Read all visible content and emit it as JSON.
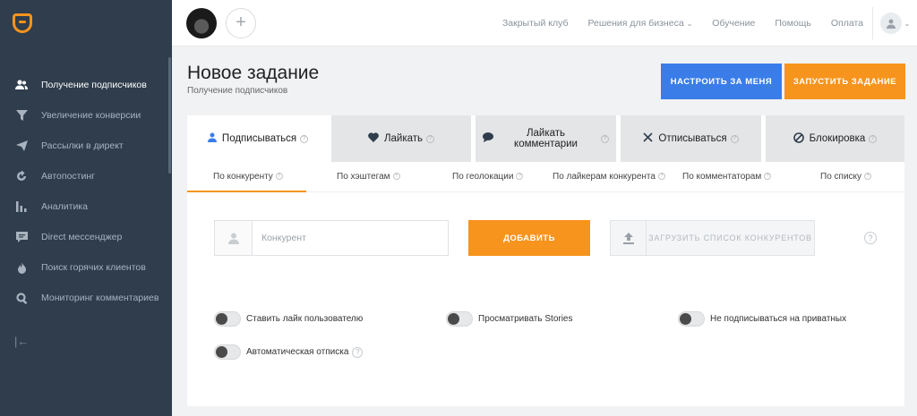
{
  "sidebar": {
    "items": [
      {
        "label": "Получение подписчиков",
        "icon": "users-icon",
        "active": true
      },
      {
        "label": "Увеличение конверсии",
        "icon": "funnel-icon",
        "active": false
      },
      {
        "label": "Рассылки в директ",
        "icon": "paper-plane-icon",
        "active": false
      },
      {
        "label": "Автопостинг",
        "icon": "refresh-icon",
        "active": false
      },
      {
        "label": "Аналитика",
        "icon": "bar-chart-icon",
        "active": false
      },
      {
        "label": "Direct мессенджер",
        "icon": "chat-icon",
        "active": false
      },
      {
        "label": "Поиск горячих клиентов",
        "icon": "fire-icon",
        "active": false
      },
      {
        "label": "Мониторинг комментариев",
        "icon": "search-icon",
        "active": false
      }
    ],
    "collapse_glyph": "|←"
  },
  "topbar": {
    "add_glyph": "+",
    "nav": [
      "Закрытый клуб",
      "Решения для бизнеса",
      "Обучение",
      "Помощь",
      "Оплата"
    ]
  },
  "header": {
    "title": "Новое задание",
    "subtitle": "Получение подписчиков",
    "setup_button": "НАСТРОИТЬ ЗА МЕНЯ",
    "run_button": "ЗАПУСТИТЬ ЗАДАНИЕ"
  },
  "tabs": [
    {
      "label": "Подписываться",
      "icon": "user-icon"
    },
    {
      "label": "Лайкать",
      "icon": "heart-icon"
    },
    {
      "label": "Лайкать комментарии",
      "icon": "comment-icon"
    },
    {
      "label": "Отписываться",
      "icon": "x-icon"
    },
    {
      "label": "Блокировка",
      "icon": "block-icon"
    }
  ],
  "subtabs": [
    "По конкуренту",
    "По хэштегам",
    "По геолокации",
    "По лайкерам конкурента",
    "По комментаторам",
    "По списку"
  ],
  "form": {
    "competitor_placeholder": "Конкурент",
    "add_button": "ДОБАВИТЬ",
    "upload_button": "ЗАГРУЗИТЬ СПИСОК КОНКУРЕНТОВ",
    "help_glyph": "?"
  },
  "toggles": [
    {
      "label": "Ставить лайк пользователю",
      "on": false
    },
    {
      "label": "Просматривать Stories",
      "on": false
    },
    {
      "label": "Не подписываться на приватных",
      "on": false
    },
    {
      "label": "Автоматическая отписка",
      "on": false
    }
  ],
  "colors": {
    "accent_orange": "#f7941d",
    "accent_blue": "#3a7de9",
    "sidebar": "#2f3d4c"
  }
}
